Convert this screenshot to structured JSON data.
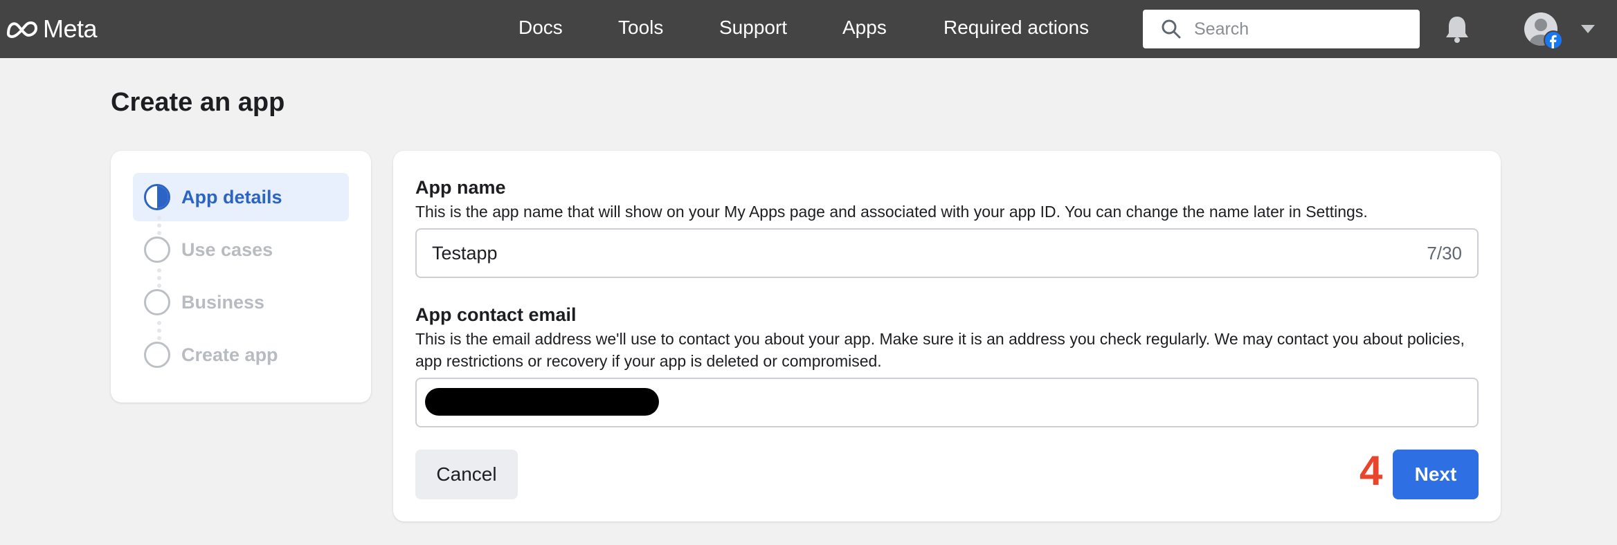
{
  "header": {
    "brand": "Meta",
    "nav": [
      "Docs",
      "Tools",
      "Support",
      "Apps",
      "Required actions"
    ],
    "search_placeholder": "Search",
    "icons": [
      "meta-logo-icon",
      "search-icon",
      "bell-icon",
      "avatar",
      "facebook-icon",
      "chevron-down-icon"
    ]
  },
  "page": {
    "title": "Create an app"
  },
  "steps": [
    {
      "label": "App details",
      "state": "in-progress"
    },
    {
      "label": "Use cases",
      "state": "pending"
    },
    {
      "label": "Business",
      "state": "pending"
    },
    {
      "label": "Create app",
      "state": "pending"
    }
  ],
  "form": {
    "app_name": {
      "label": "App name",
      "help": "This is the app name that will show on your My Apps page and associated with your app ID. You can change the name later in Settings.",
      "value": "Testapp",
      "counter": "7/30"
    },
    "contact_email": {
      "label": "App contact email",
      "help": "This is the email address we'll use to contact you about your app. Make sure it is an address you check regularly. We may contact you about policies, app restrictions or recovery if your app is deleted or compromised.",
      "value_redacted": true
    },
    "cancel_label": "Cancel",
    "next_label": "Next",
    "annotation": "4"
  },
  "colors": {
    "header_bg": "#444444",
    "accent": "#2c64c6",
    "next_button": "#2f6fe4",
    "annotation": "#e8452c"
  }
}
